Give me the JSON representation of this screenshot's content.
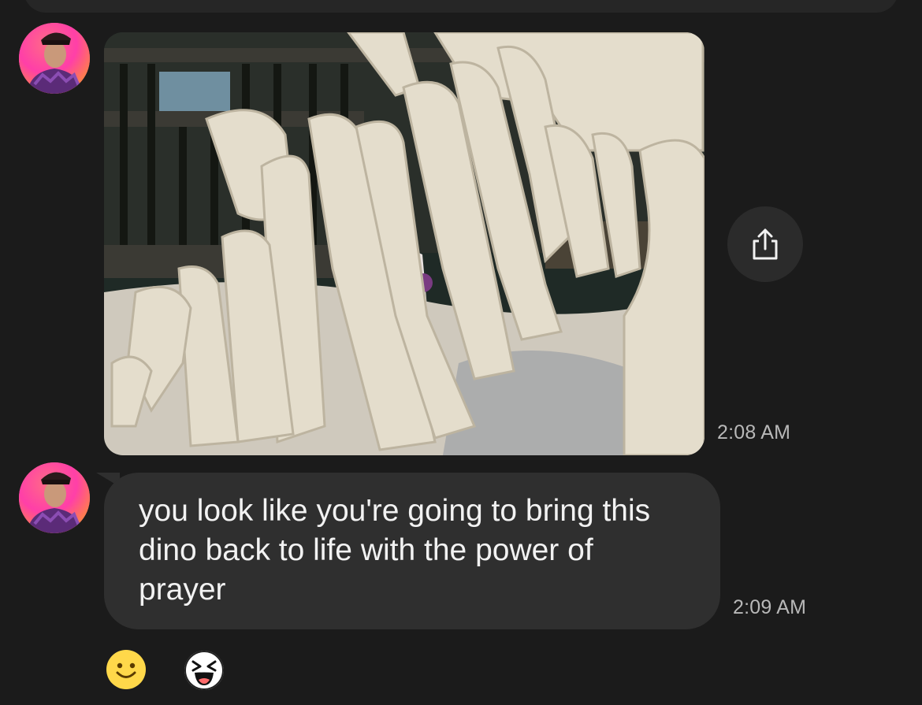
{
  "messages": [
    {
      "type": "image",
      "sender_avatar": "avatar-icon",
      "image_description_icon": "photo-icon",
      "timestamp": "2:08 AM",
      "action_icon": "share-icon"
    },
    {
      "type": "text",
      "sender_avatar": "avatar-icon",
      "text": "you look like you're going to bring this dino back to life with the power of prayer",
      "timestamp": "2:09 AM"
    }
  ],
  "reactions": [
    {
      "icon": "slightly-smiling-face-icon"
    },
    {
      "icon": "laughing-face-icon"
    }
  ],
  "colors": {
    "background": "#1b1b1b",
    "bubble": "#2f2f2f",
    "share_button": "#2b2b2b",
    "timestamp": "#b8b8b8",
    "text": "#f2f2f2",
    "emoji_yellow": "#ffd84a"
  }
}
